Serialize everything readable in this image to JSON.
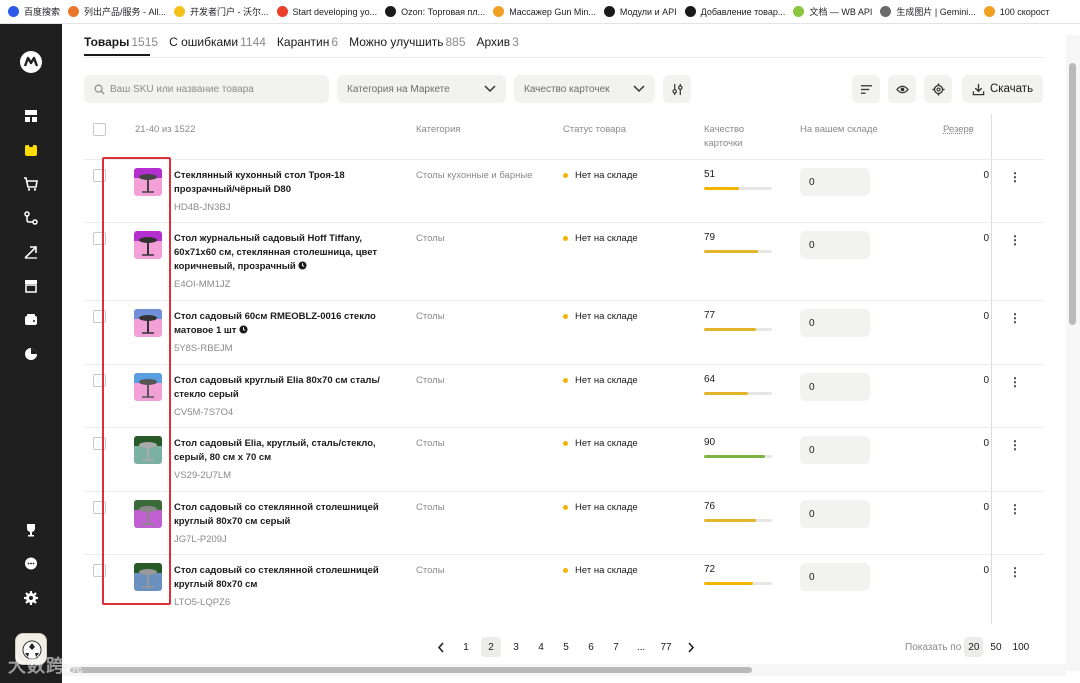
{
  "bookmarks": [
    {
      "label": "百度搜索",
      "color": "#2b58e8"
    },
    {
      "label": "列出产品/服务 - All...",
      "color": "#e8772b"
    },
    {
      "label": "开发者门户 - 沃尔...",
      "color": "#f2c21b"
    },
    {
      "label": "Start developing yo...",
      "color": "#e8402b"
    },
    {
      "label": "Ozon: Торговая пл...",
      "color": "#1a1a1a"
    },
    {
      "label": "Массажер Gun Min...",
      "color": "#f0a020"
    },
    {
      "label": "Модули и API",
      "color": "#1a1a1a"
    },
    {
      "label": "Добавление товар...",
      "color": "#1a1a1a"
    },
    {
      "label": "文档 — WB API",
      "color": "#8cc63f"
    },
    {
      "label": "生成图片 | Gemini...",
      "color": "#6a6a6a"
    },
    {
      "label": "100 скорост",
      "color": "#f0a020"
    }
  ],
  "tabs": [
    {
      "label": "Товары",
      "count": "1515",
      "active": true
    },
    {
      "label": "С ошибками",
      "count": "1144",
      "active": false
    },
    {
      "label": "Карантин",
      "count": "6",
      "active": false
    },
    {
      "label": "Можно улучшить",
      "count": "885",
      "active": false
    },
    {
      "label": "Архив",
      "count": "3",
      "active": false
    }
  ],
  "filters": {
    "search_placeholder": "Ваш SKU или название товара",
    "category_label": "Категория на Маркете",
    "quality_label": "Качество карточек",
    "download_label": "Скачать"
  },
  "table": {
    "range": "21-40 из 1522",
    "col_category": "Категория",
    "col_status": "Статус товара",
    "col_quality_1": "Качество",
    "col_quality_2": "карточки",
    "col_stock": "На вашем складе",
    "col_reserve": "Резерв",
    "rows": [
      {
        "name": "Стеклянный кухонный стол Троя-18 прозрачный/чёрный D80",
        "sku": "HD4B-JN3BJ",
        "category": "Столы кухонные и барные",
        "status": "Нет на складе",
        "quality": "51",
        "quality_pct": 51,
        "bar_color": "#f4b400",
        "stock": "0",
        "reserve": "0",
        "clock": false
      },
      {
        "name": "Стол журнальный садовый Hoff Tiffany, 60x71x60 см, стеклянная столешница, цвет коричневый, прозрачный",
        "sku": "E4OI-MM1JZ",
        "category": "Столы",
        "status": "Нет на складе",
        "quality": "79",
        "quality_pct": 79,
        "bar_color": "#e3b52a",
        "stock": "0",
        "reserve": "0",
        "clock": true
      },
      {
        "name": "Стол садовый 60см RMEOBLZ-0016 стекло матовое 1 шт",
        "sku": "5Y8S-RBEJM",
        "category": "Столы",
        "status": "Нет на складе",
        "quality": "77",
        "quality_pct": 77,
        "bar_color": "#e3b52a",
        "stock": "0",
        "reserve": "0",
        "clock": true
      },
      {
        "name": "Стол садовый круглый Elia 80x70 см сталь/стекло серый",
        "sku": "CV5M-7S7O4",
        "category": "Столы",
        "status": "Нет на складе",
        "quality": "64",
        "quality_pct": 64,
        "bar_color": "#e3b52a",
        "stock": "0",
        "reserve": "0",
        "clock": false
      },
      {
        "name": "Стол садовый Elia, круглый, сталь/стекло, серый, 80 см x 70 см",
        "sku": "VS29-2U7LM",
        "category": "Столы",
        "status": "Нет на складе",
        "quality": "90",
        "quality_pct": 90,
        "bar_color": "#7cb342",
        "stock": "0",
        "reserve": "0",
        "clock": false
      },
      {
        "name": "Стол садовый со стеклянной столешницей круглый 80x70 см серый",
        "sku": "JG7L-P209J",
        "category": "Столы",
        "status": "Нет на складе",
        "quality": "76",
        "quality_pct": 76,
        "bar_color": "#e3b52a",
        "stock": "0",
        "reserve": "0",
        "clock": false
      },
      {
        "name": "Стол садовый со стеклянной столешницей круглый 80x70 см",
        "sku": "LTO5-LQPZ6",
        "category": "Столы",
        "status": "Нет на складе",
        "quality": "72",
        "quality_pct": 72,
        "bar_color": "#f4b400",
        "stock": "0",
        "reserve": "0",
        "clock": false
      }
    ]
  },
  "pagination": {
    "pages": [
      "1",
      "2",
      "3",
      "4",
      "5",
      "6",
      "7",
      "...",
      "77"
    ],
    "current": "2",
    "show_label": "Показать по",
    "page_sizes": [
      "20",
      "50",
      "100"
    ],
    "page_size_active": "20"
  },
  "watermark": "大数跨境"
}
